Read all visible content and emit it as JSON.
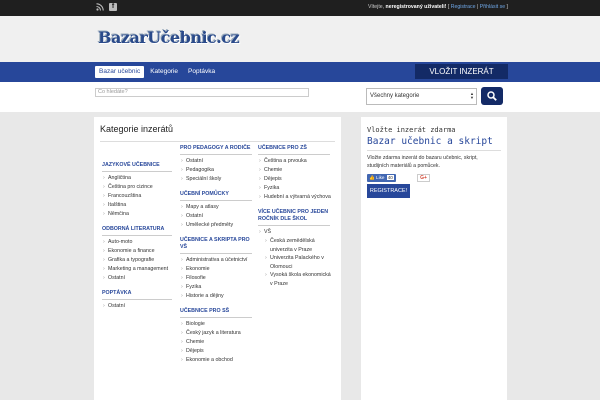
{
  "topbar": {
    "user_prefix": "Vítejte, ",
    "user_name": "neregistrovaný uživateli!",
    "bracket_open": " [ ",
    "register_label": "Registrace",
    "separator": " | ",
    "login_label": "Přihlásit se",
    "bracket_close": " ]",
    "icons": [
      "rss-icon",
      "facebook-icon"
    ]
  },
  "logo": {
    "text": "BazarUčebnic.cz"
  },
  "nav": {
    "items": [
      {
        "label": "Bazar učebnic",
        "active": true
      },
      {
        "label": "Kategorie",
        "active": false
      },
      {
        "label": "Poptávka",
        "active": false
      }
    ],
    "post_label": "VLOŽIT INZERÁT"
  },
  "search": {
    "placeholder": "Co hledáte?",
    "category_value": "Všechny kategorie"
  },
  "main": {
    "title": "Kategorie inzerátů",
    "col1": [
      {
        "title": "JAZYKOVÉ UČEBNICE",
        "items": [
          "Angličtina",
          "Čeština pro cizince",
          "Francouzština",
          "Italština",
          "Němčina"
        ]
      },
      {
        "title": "ODBORNÁ LITERATURA",
        "items": [
          "Auto-moto",
          "Ekonomie a finance",
          "Grafika a typografie",
          "Marketing a management",
          "Ostatní"
        ]
      },
      {
        "title": "POPTÁVKA",
        "items": [
          "Ostatní"
        ]
      }
    ],
    "col2": [
      {
        "title": "PRO PEDAGOGY A RODIČE",
        "items": [
          "Ostatní",
          "Pedagogika",
          "Speciální školy"
        ]
      },
      {
        "title": "UČEBNÍ POMŮCKY",
        "items": [
          "Mapy a atlasy",
          "Ostatní",
          "Umělecké předměty"
        ]
      },
      {
        "title": "UČEBNICE A SKRIPTA PRO VŠ",
        "items": [
          "Administrativa a účetnictví",
          "Ekonomie",
          "Filosofie",
          "Fyzika",
          "Historie a dějiny"
        ]
      },
      {
        "title": "UČEBNICE PRO SŠ",
        "items": [
          "Biologie",
          "Český jazyk a literatura",
          "Chemie",
          "Dějepis",
          "Ekonomie a obchod"
        ]
      }
    ],
    "col3": [
      {
        "title": "UČEBNICE PRO ZŠ",
        "items": [
          "Čeština a prvouka",
          "Chemie",
          "Dějepis",
          "Fyzika",
          "Hudební a výtvarná výchova"
        ]
      },
      {
        "title": "VÍCE UČEBNIC PRO JEDEN ROČNÍK DLE ŠKOL",
        "items": [
          "VŠ"
        ],
        "sub": [
          "Česká zemědělská univerzita v Praze",
          "Univerzita Palackého v Olomouci",
          "Vysoká škola ekonomická v Praze"
        ]
      }
    ]
  },
  "side": {
    "small_title": "Vložte inzerát zdarma",
    "big_title": "Bazar učebnic a skript",
    "desc": "Vložte zdarma inzerát do bazaru učebnic, skript, studijních materiálů a pomůcek.",
    "like_label": "Like",
    "like_count": "40",
    "gplus_label": "G+",
    "register_button": "REGISTRACE!"
  },
  "colors": {
    "nav": "#27479a",
    "dark_button": "#132a66",
    "topbar": "#1f1f1f"
  }
}
